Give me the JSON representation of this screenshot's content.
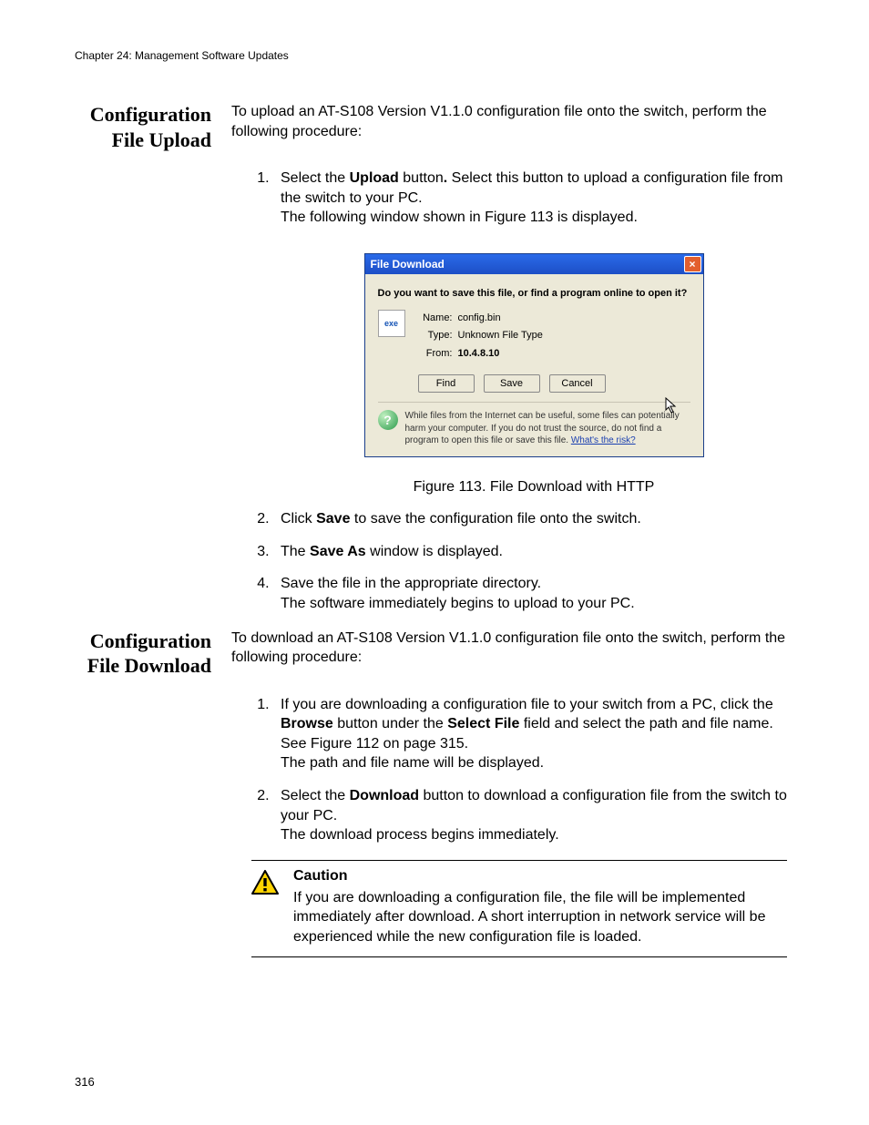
{
  "chapter_header": "Chapter 24: Management Software Updates",
  "page_number": "316",
  "sections": {
    "upload": {
      "heading_line1": "Configuration",
      "heading_line2": "File Upload",
      "intro": "To upload an AT-S108 Version V1.1.0 configuration file onto the switch, perform the following procedure:",
      "step1_pre": "Select the ",
      "step1_bold1": "Upload",
      "step1_mid": " button",
      "step1_dot": ". ",
      "step1_rest": "Select this button to upload a configuration file from the switch to your PC.",
      "step1_line2": "The following window shown in Figure 113 is displayed.",
      "figure_caption": "Figure 113. File Download with HTTP",
      "step2_pre": "Click ",
      "step2_bold": "Save",
      "step2_post": " to save the configuration file onto the switch.",
      "step3_pre": "The ",
      "step3_bold": "Save As",
      "step3_post": " window is displayed.",
      "step4_line1": "Save the file in the appropriate directory.",
      "step4_line2": "The software immediately begins to upload to your PC."
    },
    "download": {
      "heading_line1": "Configuration",
      "heading_line2": "File Download",
      "intro": "To download an AT-S108 Version V1.1.0 configuration file onto the switch, perform the following procedure:",
      "step1_pre": "If you are downloading a configuration file to your switch from a PC, click the ",
      "step1_bold1": "Browse",
      "step1_mid": " button under the ",
      "step1_bold2": "Select File",
      "step1_post": " field and select the path and file name. See Figure 112 on page 315.",
      "step1_line2": "The path and file name will be displayed.",
      "step2_pre": "Select the ",
      "step2_bold": "Download",
      "step2_post": " button to download a configuration file from the switch to your PC.",
      "step2_line2": "The download process begins immediately."
    },
    "caution": {
      "title": "Caution",
      "text": "If you are downloading a configuration file, the file will be implemented immediately after download. A short interruption in network service will be experienced while the new configuration file is loaded."
    }
  },
  "dialog": {
    "title": "File Download",
    "question": "Do you want to save this file, or find a program online to open it?",
    "name_label": "Name:",
    "name_value": "config.bin",
    "type_label": "Type:",
    "type_value": "Unknown File Type",
    "from_label": "From:",
    "from_value": "10.4.8.10",
    "buttons": {
      "find": "Find",
      "save": "Save",
      "cancel": "Cancel"
    },
    "warning_text_pre": "While files from the Internet can be useful, some files can potentially harm your computer. If you do not trust the source, do not find a program to open this file or save this file. ",
    "risk_link": "What's the risk?"
  }
}
